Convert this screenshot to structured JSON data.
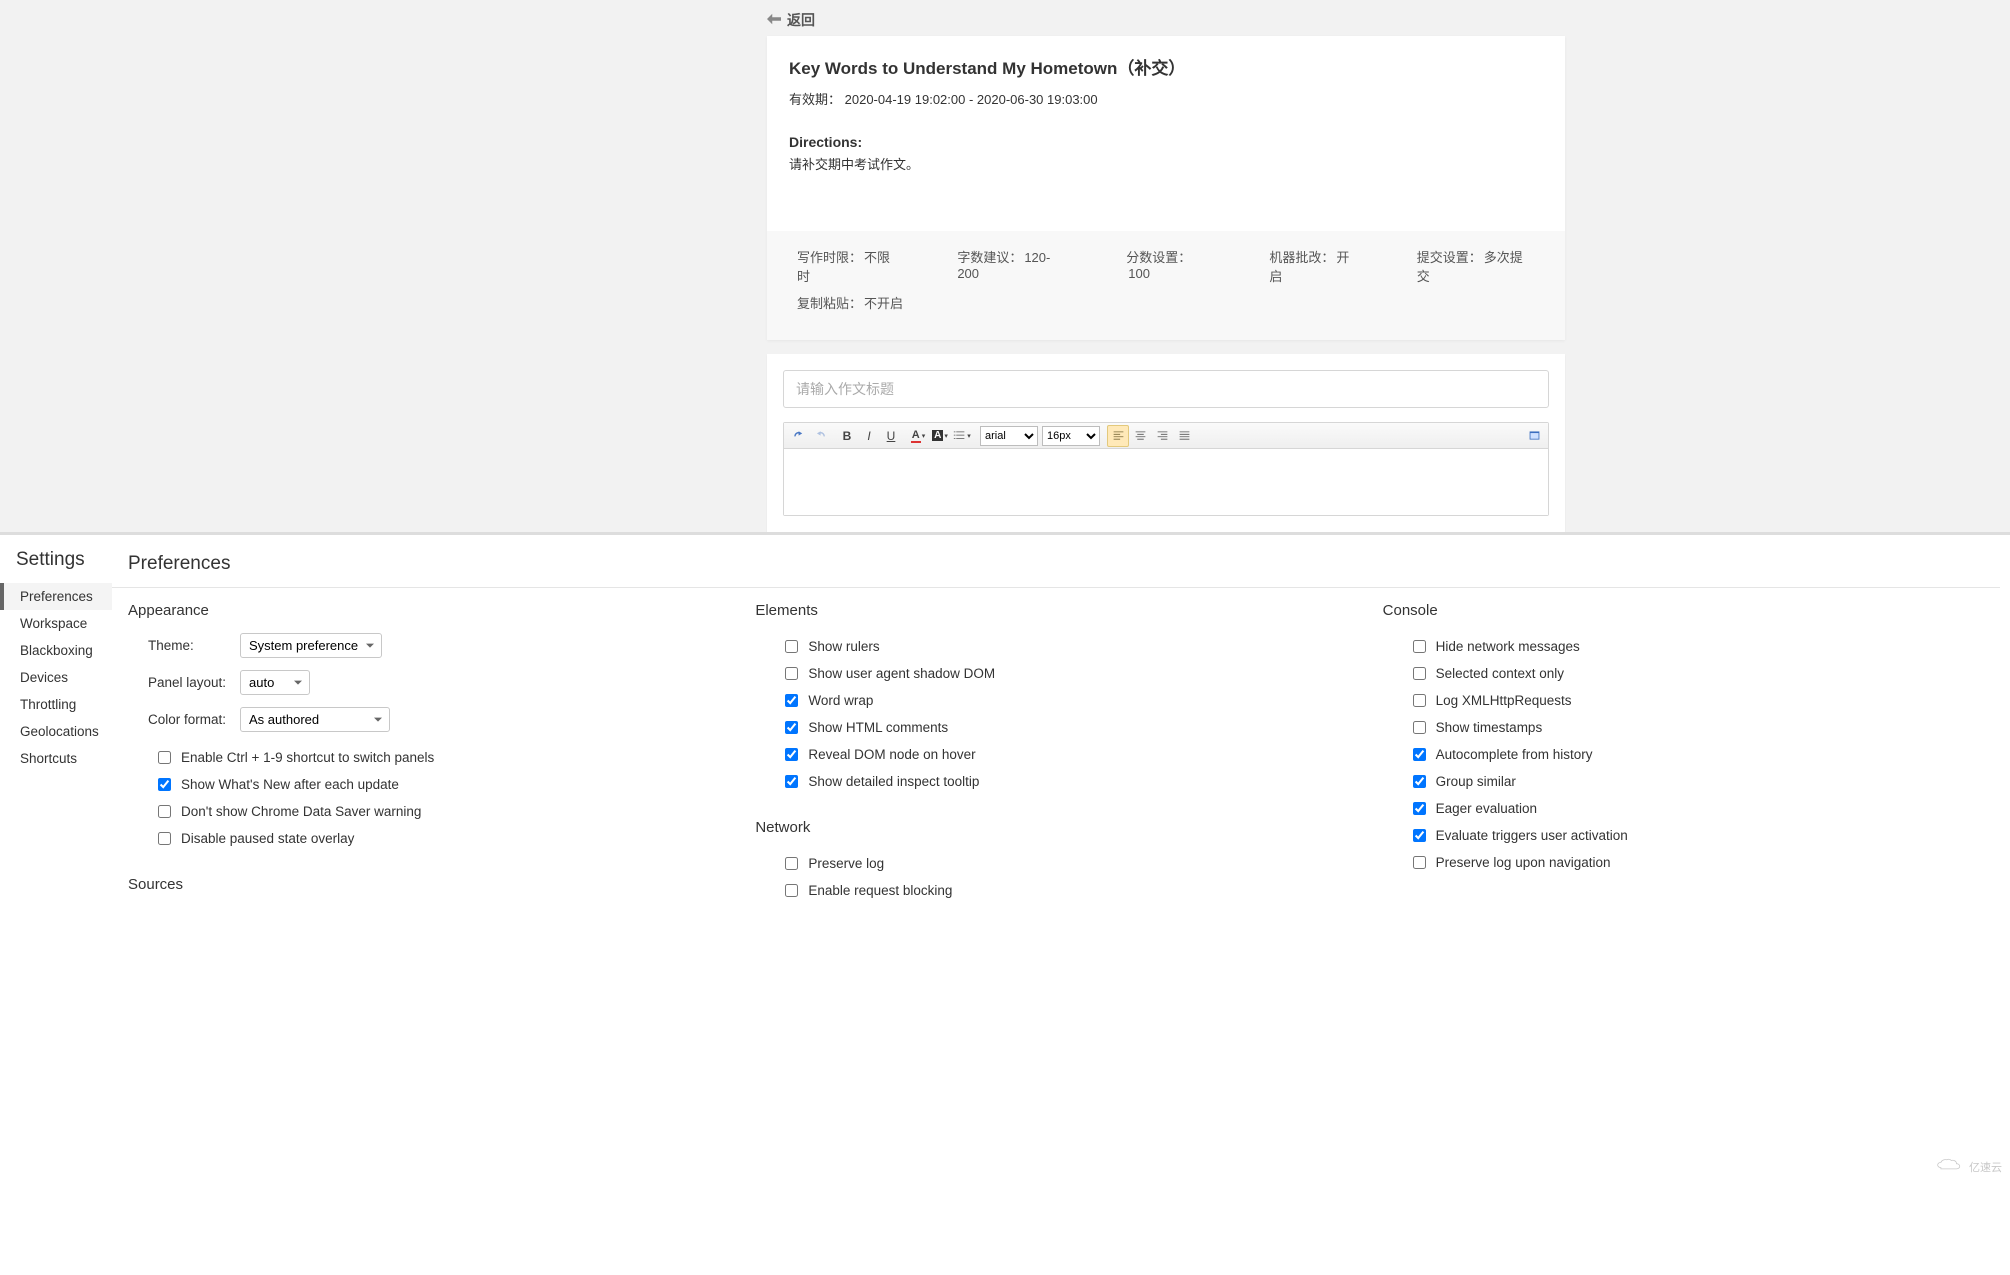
{
  "top": {
    "back_label": "返回",
    "assignment_title": "Key Words to Understand My Hometown（补交）",
    "validity_label": "有效期：",
    "validity_value": "2020-04-19 19:02:00 - 2020-06-30 19:03:00",
    "directions_label": "Directions:",
    "directions_text": "请补交期中考试作文。",
    "meta": [
      {
        "label": "写作时限：",
        "value": "不限时"
      },
      {
        "label": "字数建议：",
        "value": "120-200"
      },
      {
        "label": "分数设置：",
        "value": "100"
      },
      {
        "label": "机器批改：",
        "value": "开启"
      },
      {
        "label": "提交设置：",
        "value": "多次提交"
      }
    ],
    "meta2": [
      {
        "label": "复制粘贴：",
        "value": "不开启"
      }
    ],
    "title_placeholder": "请输入作文标题",
    "font_family": "arial",
    "font_size": "16px"
  },
  "dt": {
    "sidebar_title": "Settings",
    "nav": [
      "Preferences",
      "Workspace",
      "Blackboxing",
      "Devices",
      "Throttling",
      "Geolocations",
      "Shortcuts"
    ],
    "page_title": "Preferences",
    "appearance": {
      "title": "Appearance",
      "theme_label": "Theme:",
      "theme_value": "System preference",
      "layout_label": "Panel layout:",
      "layout_value": "auto",
      "colorfmt_label": "Color format:",
      "colorfmt_value": "As authored",
      "checks": [
        {
          "label": "Enable Ctrl + 1-9 shortcut to switch panels",
          "checked": false
        },
        {
          "label": "Show What's New after each update",
          "checked": true
        },
        {
          "label": "Don't show Chrome Data Saver warning",
          "checked": false
        },
        {
          "label": "Disable paused state overlay",
          "checked": false
        }
      ]
    },
    "sources_title": "Sources",
    "elements": {
      "title": "Elements",
      "checks": [
        {
          "label": "Show rulers",
          "checked": false
        },
        {
          "label": "Show user agent shadow DOM",
          "checked": false
        },
        {
          "label": "Word wrap",
          "checked": true
        },
        {
          "label": "Show HTML comments",
          "checked": true
        },
        {
          "label": "Reveal DOM node on hover",
          "checked": true
        },
        {
          "label": "Show detailed inspect tooltip",
          "checked": true
        }
      ]
    },
    "network": {
      "title": "Network",
      "checks": [
        {
          "label": "Preserve log",
          "checked": false
        },
        {
          "label": "Enable request blocking",
          "checked": false
        }
      ]
    },
    "console": {
      "title": "Console",
      "checks": [
        {
          "label": "Hide network messages",
          "checked": false
        },
        {
          "label": "Selected context only",
          "checked": false
        },
        {
          "label": "Log XMLHttpRequests",
          "checked": false
        },
        {
          "label": "Show timestamps",
          "checked": false
        },
        {
          "label": "Autocomplete from history",
          "checked": true
        },
        {
          "label": "Group similar",
          "checked": true
        },
        {
          "label": "Eager evaluation",
          "checked": true
        },
        {
          "label": "Evaluate triggers user activation",
          "checked": true
        },
        {
          "label": "Preserve log upon navigation",
          "checked": false
        }
      ]
    }
  },
  "watermark_text": "亿速云"
}
